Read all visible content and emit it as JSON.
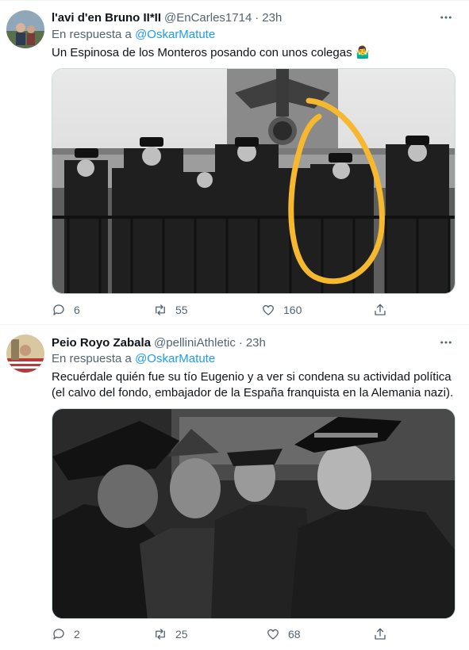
{
  "tweets": [
    {
      "name": "l'avi d'en Bruno II*II",
      "handle": "@EnCarles1714",
      "separator": "·",
      "time": "23h",
      "reply_prefix": "En respuesta a",
      "reply_to": "@OskarMatute",
      "text": "Un Espinosa de los Monteros posando con unos colegas 🤷‍♂️",
      "image_icon": "photo-officers-balcony",
      "replies": "6",
      "retweets": "55",
      "likes": "160",
      "annotation_color": "#f5b82e"
    },
    {
      "name": "Peio Royo Zabala",
      "handle": "@pelliniAthletic",
      "separator": "·",
      "time": "23h",
      "reply_prefix": "En respuesta a",
      "reply_to": "@OskarMatute",
      "text": "Recuérdale quién fue su tío Eugenio y a ver si condena su actividad política (el calvo del fondo, embajador de la España franquista en la Alemania nazi).",
      "image_icon": "photo-officers-meeting",
      "replies": "2",
      "retweets": "25",
      "likes": "68"
    }
  ],
  "colors": {
    "text": "#0f1419",
    "secondary": "#536471",
    "link": "#1d9bf0",
    "border": "#eff3f4"
  }
}
